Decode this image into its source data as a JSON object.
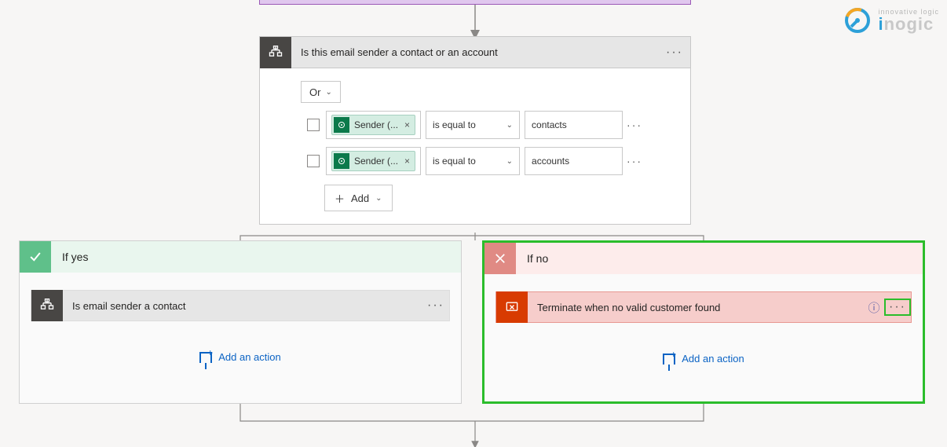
{
  "condition": {
    "title": "Is this email sender a contact or an account",
    "group_operator": "Or",
    "rows": [
      {
        "token_label": "Sender (...",
        "operator": "is equal to",
        "value": "contacts"
      },
      {
        "token_label": "Sender (...",
        "operator": "is equal to",
        "value": "accounts"
      }
    ],
    "add_label": "Add"
  },
  "branches": {
    "yes": {
      "title": "If yes",
      "action_title": "Is email sender a contact",
      "add_action": "Add an action"
    },
    "no": {
      "title": "If no",
      "action_title": "Terminate when no valid customer found",
      "add_action": "Add an action"
    }
  },
  "logo": {
    "tagline": "innovative logic",
    "brand_prefix": "i",
    "brand_rest": "nogic"
  }
}
